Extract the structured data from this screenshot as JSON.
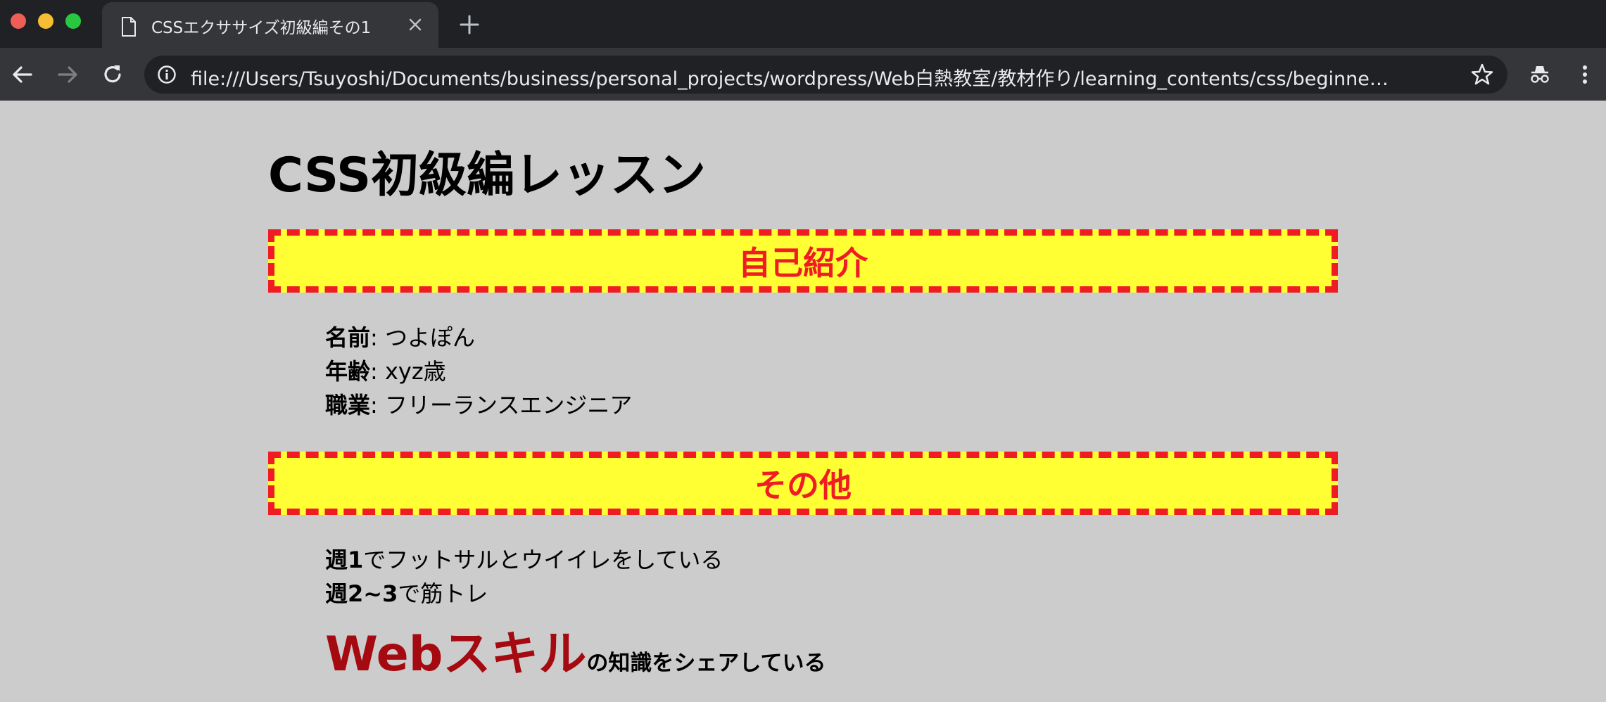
{
  "browser": {
    "tab_title": "CSSエクササイズ初級編その1",
    "url": "file:///Users/Tsuyoshi/Documents/business/personal_projects/wordpress/Web白熱教室/教材作り/learning_contents/css/beginner/css_excer..."
  },
  "page": {
    "title": "CSS初級編レッスン",
    "sections": [
      {
        "heading": "自己紹介",
        "rows": [
          {
            "label": "名前",
            "sep": ": ",
            "value": "つよぽん"
          },
          {
            "label": "年齢",
            "sep": ": ",
            "value": "xyz歳"
          },
          {
            "label": "職業",
            "sep": ": ",
            "value": "フリーランスエンジニア"
          }
        ]
      },
      {
        "heading": "その他",
        "rows": [
          {
            "bold": "週1",
            "text": "でフットサルとウイイレをしている"
          },
          {
            "bold": "週2~3",
            "text": "で筋トレ"
          }
        ],
        "highlight": {
          "big": "Webスキル",
          "tail": "の知識をシェアしている"
        }
      }
    ]
  },
  "colors": {
    "heading_bg": "#ffff33",
    "heading_border": "#ef1c24",
    "heading_text": "#ef1c24",
    "highlight_text": "#a40a10",
    "page_bg": "#cccccc"
  },
  "icons": [
    "document-icon",
    "close-icon",
    "plus-icon",
    "back-arrow-icon",
    "forward-arrow-icon",
    "reload-icon",
    "info-icon",
    "star-icon",
    "incognito-icon",
    "menu-dots-icon"
  ]
}
